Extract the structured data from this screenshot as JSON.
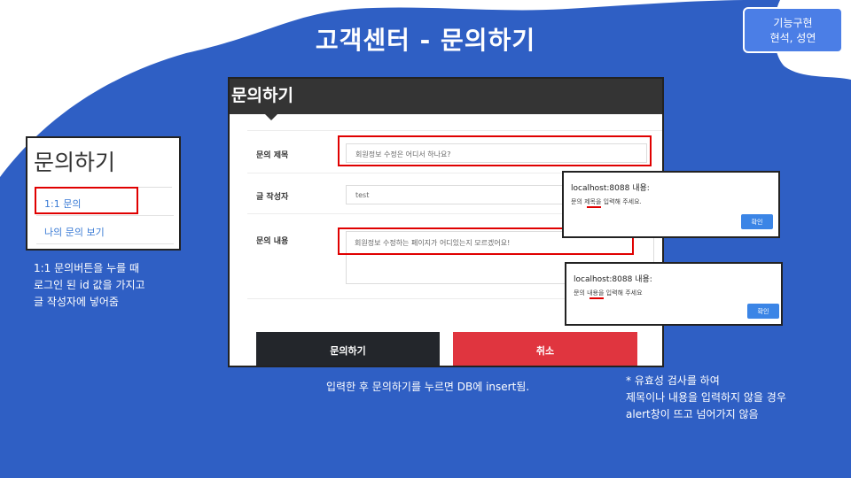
{
  "slide": {
    "title": "고객센터 - 문의하기",
    "tag_line1": "기능구현",
    "tag_line2": "현석, 성연"
  },
  "sidebar": {
    "title": "문의하기",
    "items": [
      {
        "label": "1:1 문의"
      },
      {
        "label": "나의 문의 보기"
      }
    ]
  },
  "notes": {
    "left": [
      "1:1 문의버튼을 누를 때",
      "로그인 된 id 값을 가지고",
      "글 작성자에 넣어줌"
    ],
    "bottom": "입력한 후 문의하기를 누르면 DB에 insert됨.",
    "right": [
      "* 유효성 검사를 하여",
      "제목이나 내용을 입력하지 않을 경우",
      "alert창이 뜨고 넘어가지 않음"
    ]
  },
  "form": {
    "header": "문의하기",
    "title_label": "문의 제목",
    "title_value": "회원정보 수정은 어디서 하나요?",
    "author_label": "글 작성자",
    "author_value": "test",
    "content_label": "문의 내용",
    "content_value": "회원정보 수정하는 페이지가 어디있는지 모르겠어요!",
    "submit_label": "문의하기",
    "cancel_label": "취소"
  },
  "alerts": [
    {
      "host": "localhost:8088 내용:",
      "message": "문의 제목을 입력해 주세요.",
      "button": "확인"
    },
    {
      "host": "localhost:8088 내용:",
      "message": "문의 내용을 입력해 주세요",
      "button": "확인"
    }
  ],
  "colors": {
    "background_blue": "#2f5fc4",
    "highlight_red": "#e00000",
    "cancel_red": "#e0353f",
    "dark": "#23262b"
  }
}
